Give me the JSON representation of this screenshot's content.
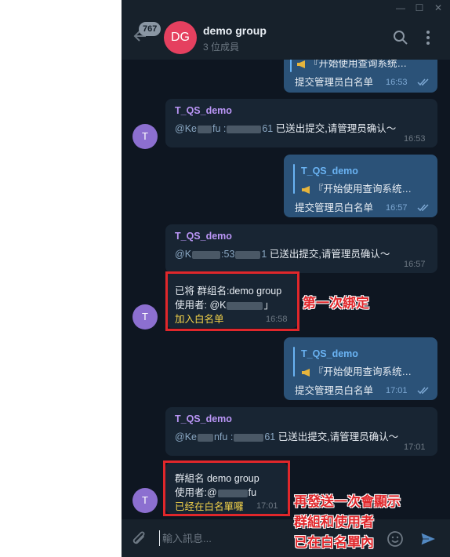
{
  "window": {
    "minimize": "—",
    "maximize": "☐",
    "close": "✕"
  },
  "header": {
    "unread_count": "767",
    "avatar_initials": "DG",
    "title": "demo group",
    "subtitle": "3 位成員",
    "avatar_color": "#e5405f"
  },
  "messages": [
    {
      "direction": "out",
      "reply_text": "『开始使用查询系统…",
      "text": "提交管理员白名单",
      "time": "16:53"
    },
    {
      "direction": "in",
      "sender": "T_QS_demo",
      "text_prefix": "@Ke",
      "text_mid1": "fu :",
      "text_mid2": "61",
      "text": "已送出提交,请管理员确认～",
      "time": "16:53",
      "avatar": "T"
    },
    {
      "direction": "out",
      "reply_name": "T_QS_demo",
      "reply_text": "『开始使用查询系统…",
      "text": "提交管理员白名单",
      "time": "16:57"
    },
    {
      "direction": "in",
      "sender": "T_QS_demo",
      "text_prefix": "@K",
      "text_mid1": ":53",
      "text_mid2": "1",
      "text": "已送出提交,请管理员确认～",
      "time": "16:57"
    },
    {
      "direction": "in",
      "line1": "已将 群组名:demo group",
      "line2_prefix": "使用者: @K",
      "line2_suffix": "」",
      "line3": "加入白名单",
      "time": "16:58",
      "avatar": "T"
    },
    {
      "direction": "out",
      "reply_name": "T_QS_demo",
      "reply_text": "『开始使用查询系统…",
      "text": "提交管理员白名单",
      "time": "17:01"
    },
    {
      "direction": "in",
      "sender": "T_QS_demo",
      "text_prefix": "@Ke",
      "text_mid1": "nfu :",
      "text_mid2": "61",
      "text": "已送出提交,请管理员确认～",
      "time": "17:01"
    },
    {
      "direction": "in",
      "line1": "群組名 demo group",
      "line2_prefix": "使用者:@",
      "line2_suffix": "fu",
      "line3": "已经在白名單囉",
      "time": "17:01",
      "avatar": "T"
    }
  ],
  "annotations": {
    "first_bind": "第一次綁定",
    "resend_line1": "再發送一次會顯示",
    "resend_line2": "群組和使用者",
    "resend_line3": "已在白名單內"
  },
  "input": {
    "placeholder": "輸入訊息..."
  },
  "colors": {
    "background": "#0e1621",
    "incoming_bubble": "#182533",
    "outgoing_bubble": "#2b5278",
    "annotation_red": "#e0272b"
  }
}
